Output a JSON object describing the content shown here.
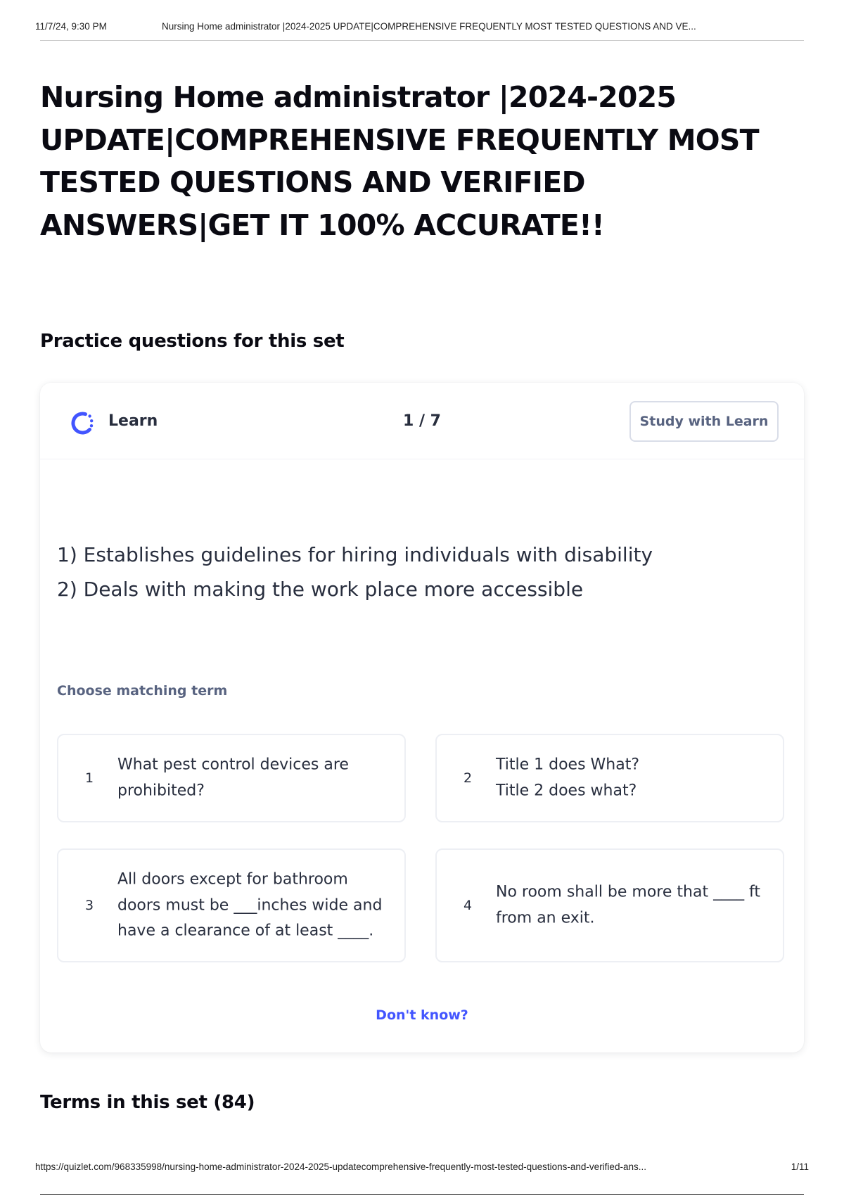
{
  "print_header": {
    "date": "11/7/24, 9:30 PM",
    "title": "Nursing Home administrator |2024-2025 UPDATE|COMPREHENSIVE FREQUENTLY MOST TESTED QUESTIONS AND VE..."
  },
  "page_title": "Nursing Home administrator |2024-2025 UPDATE|COMPREHENSIVE FREQUENTLY MOST TESTED QUESTIONS AND VERIFIED ANSWERS|GET IT 100% ACCURATE!!",
  "practice": {
    "heading": "Practice questions for this set",
    "mode_label": "Learn",
    "mode_icon": "learn-progress-ring-icon",
    "progress": "1 / 7",
    "study_button": "Study with Learn",
    "prompt_lines": [
      "1) Establishes guidelines for hiring individuals with disability",
      "2) Deals with making the work place more accessible"
    ],
    "choose_label": "Choose matching term",
    "options": [
      {
        "number": "1",
        "text": "What pest control devices are prohibited?"
      },
      {
        "number": "2",
        "text": "Title 1 does What?\nTitle 2 does what?"
      },
      {
        "number": "3",
        "text": "All doors except for bathroom doors must be ___inches wide and have a clearance of at least ____."
      },
      {
        "number": "4",
        "text": "No room shall be more that ____ ft from an exit."
      }
    ],
    "dont_know": "Don't know?"
  },
  "terms_heading": "Terms in this set (84)",
  "print_footer": {
    "url": "https://quizlet.com/968335998/nursing-home-administrator-2024-2025-updatecomprehensive-frequently-most-tested-questions-and-verified-ans...",
    "page": "1/11"
  },
  "colors": {
    "accent": "#4255ff",
    "text_primary": "#282e3e",
    "text_secondary": "#586380"
  }
}
